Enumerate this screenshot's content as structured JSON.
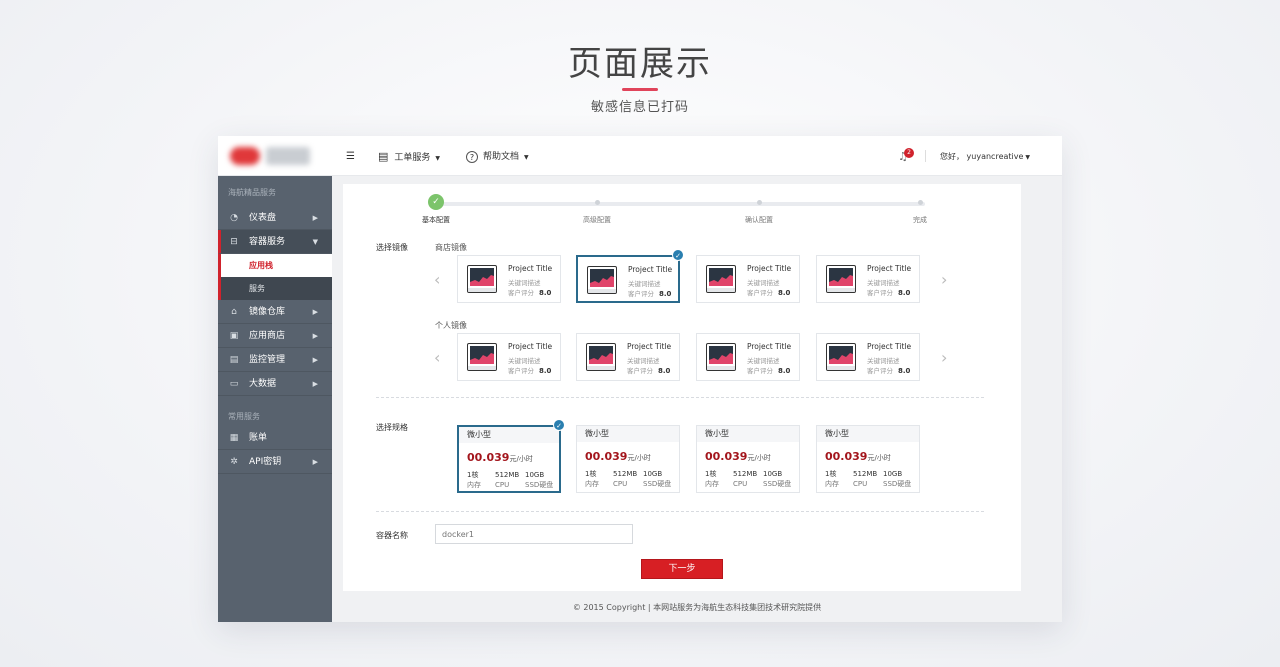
{
  "hero": {
    "title": "页面展示",
    "subtitle": "敏感信息已打码"
  },
  "sidebar": {
    "section1": "海航精品服务",
    "items": [
      {
        "label": "仪表盘",
        "icon": "dashboard-icon"
      },
      {
        "label": "容器服务",
        "icon": "container-icon"
      },
      {
        "label": "镜像仓库",
        "icon": "warehouse-icon"
      },
      {
        "label": "应用商店",
        "icon": "store-icon"
      },
      {
        "label": "监控管理",
        "icon": "monitor-icon"
      },
      {
        "label": "大数据",
        "icon": "bigdata-icon"
      }
    ],
    "subitems": [
      {
        "label": "应用栈"
      },
      {
        "label": "服务"
      }
    ],
    "section2": "常用服务",
    "items2": [
      {
        "label": "账单",
        "icon": "bill-icon"
      },
      {
        "label": "API密钥",
        "icon": "gear-icon"
      }
    ]
  },
  "topbar": {
    "ticket": "工单服务",
    "help": "帮助文档",
    "notif_count": "2",
    "user": "您好， yuyancreative"
  },
  "steps": [
    {
      "label": "基本配置"
    },
    {
      "label": "高级配置"
    },
    {
      "label": "确认配置"
    },
    {
      "label": "完成"
    }
  ],
  "image_section": {
    "label": "选择镜像",
    "store_label": "商店镜像",
    "personal_label": "个人镜像",
    "store_images": [
      {
        "title": "Project Title",
        "desc": "关键词描述",
        "rate_label": "客户评分",
        "rate": "8.0"
      },
      {
        "title": "Project Title",
        "desc": "关键词描述",
        "rate_label": "客户评分",
        "rate": "8.0"
      },
      {
        "title": "Project Title",
        "desc": "关键词描述",
        "rate_label": "客户评分",
        "rate": "8.0"
      },
      {
        "title": "Project Title",
        "desc": "关键词描述",
        "rate_label": "客户评分",
        "rate": "8.0"
      }
    ],
    "personal_images": [
      {
        "title": "Project Title",
        "desc": "关键词描述",
        "rate_label": "客户评分",
        "rate": "8.0"
      },
      {
        "title": "Project Title",
        "desc": "关键词描述",
        "rate_label": "客户评分",
        "rate": "8.0"
      },
      {
        "title": "Project Title",
        "desc": "关键词描述",
        "rate_label": "客户评分",
        "rate": "8.0"
      },
      {
        "title": "Project Title",
        "desc": "关键词描述",
        "rate_label": "客户评分",
        "rate": "8.0"
      }
    ]
  },
  "spec_section": {
    "label": "选择规格",
    "specs": [
      {
        "name": "微小型",
        "price": "00.039",
        "unit": "元/小时",
        "cores": "1核",
        "mem": "512MB",
        "disk": "10GB",
        "k1": "内存",
        "k2": "CPU",
        "k3": "SSD硬盘"
      },
      {
        "name": "微小型",
        "price": "00.039",
        "unit": "元/小时",
        "cores": "1核",
        "mem": "512MB",
        "disk": "10GB",
        "k1": "内存",
        "k2": "CPU",
        "k3": "SSD硬盘"
      },
      {
        "name": "微小型",
        "price": "00.039",
        "unit": "元/小时",
        "cores": "1核",
        "mem": "512MB",
        "disk": "10GB",
        "k1": "内存",
        "k2": "CPU",
        "k3": "SSD硬盘"
      },
      {
        "name": "微小型",
        "price": "00.039",
        "unit": "元/小时",
        "cores": "1核",
        "mem": "512MB",
        "disk": "10GB",
        "k1": "内存",
        "k2": "CPU",
        "k3": "SSD硬盘"
      }
    ]
  },
  "name_section": {
    "label": "容器名称",
    "placeholder": "docker1"
  },
  "next_button": "下一步",
  "footer": "© 2015 Copyright |   本网站服务为海航生态科技集团技术研究院提供",
  "colors": {
    "accent": "#d71f24",
    "selected": "#2a6a8c",
    "sidebar": "#58626e",
    "price": "#a3151c",
    "success": "#7cc46b"
  }
}
